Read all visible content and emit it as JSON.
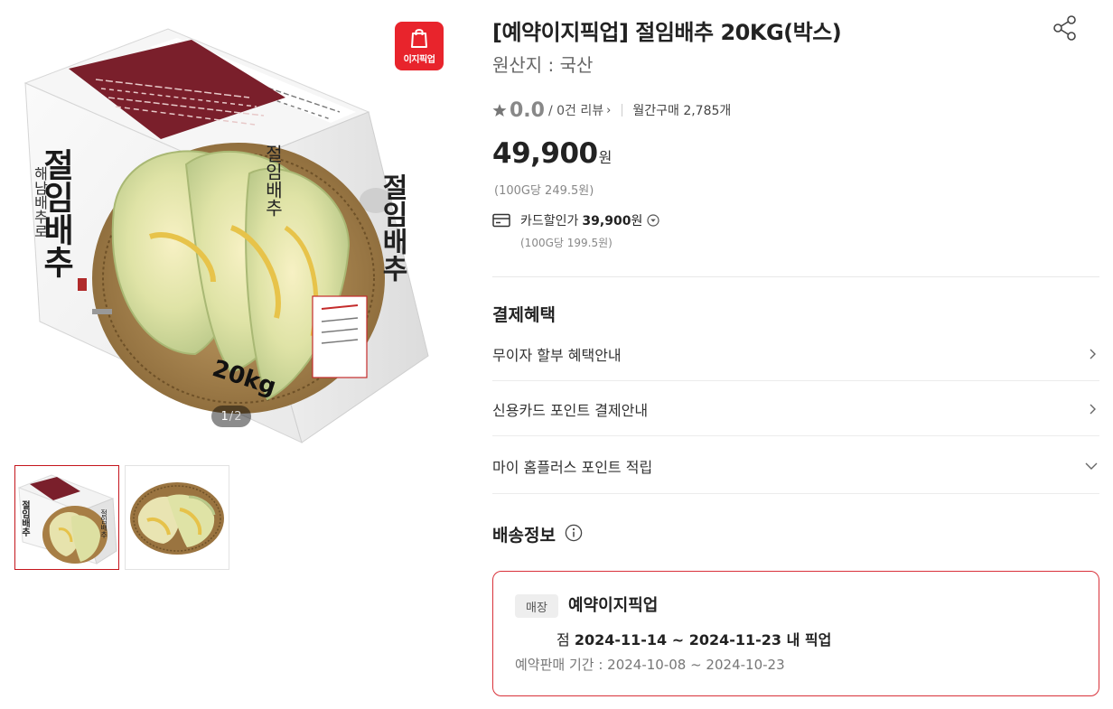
{
  "gallery": {
    "badge_label": "이지픽업",
    "pager_current": "1",
    "pager_separator": "/",
    "pager_total": "2",
    "box_weight_label": "20kg",
    "box_brand_vertical": "절임배추",
    "box_sub_vertical": "해남배추로 만든",
    "thumbnails": [
      {
        "name": "box-product-image",
        "active": true
      },
      {
        "name": "cabbage-basket-image",
        "active": false
      }
    ]
  },
  "product": {
    "title": "[예약이지픽업] 절임배추 20KG(박스)",
    "origin": "원산지 : 국산",
    "rating": "0.0",
    "review_text": "/ 0건 리뷰",
    "review_chevron": "›",
    "monthly_sales": "월간구매 2,785개",
    "price": "49,900",
    "price_unit": "원",
    "unit_price": "(100G당 249.5원)",
    "card_discount_label": "카드할인가",
    "card_discount_price": "39,900",
    "card_discount_unit": "원",
    "card_unit_price": "(100G당 199.5원)"
  },
  "benefits": {
    "title": "결제혜택",
    "items": [
      {
        "label": "무이자 할부 혜택안내",
        "icon": "chevron-right-icon"
      },
      {
        "label": "신용카드 포인트 결제안내",
        "icon": "chevron-right-icon"
      },
      {
        "label": "마이 홈플러스 포인트 적립",
        "icon": "chevron-down-icon"
      }
    ]
  },
  "delivery": {
    "title": "배송정보",
    "store_tag": "매장",
    "pickup_name": "예약이지픽업",
    "pickup_prefix": "점",
    "pickup_range": "2024-11-14 ~ 2024-11-23 내 픽업",
    "sale_period": "예약판매 기간 : 2024-10-08 ~ 2024-10-23"
  },
  "colors": {
    "accent": "#e8242c",
    "border_red": "#d9323a",
    "text": "#222222",
    "muted": "#888888"
  }
}
